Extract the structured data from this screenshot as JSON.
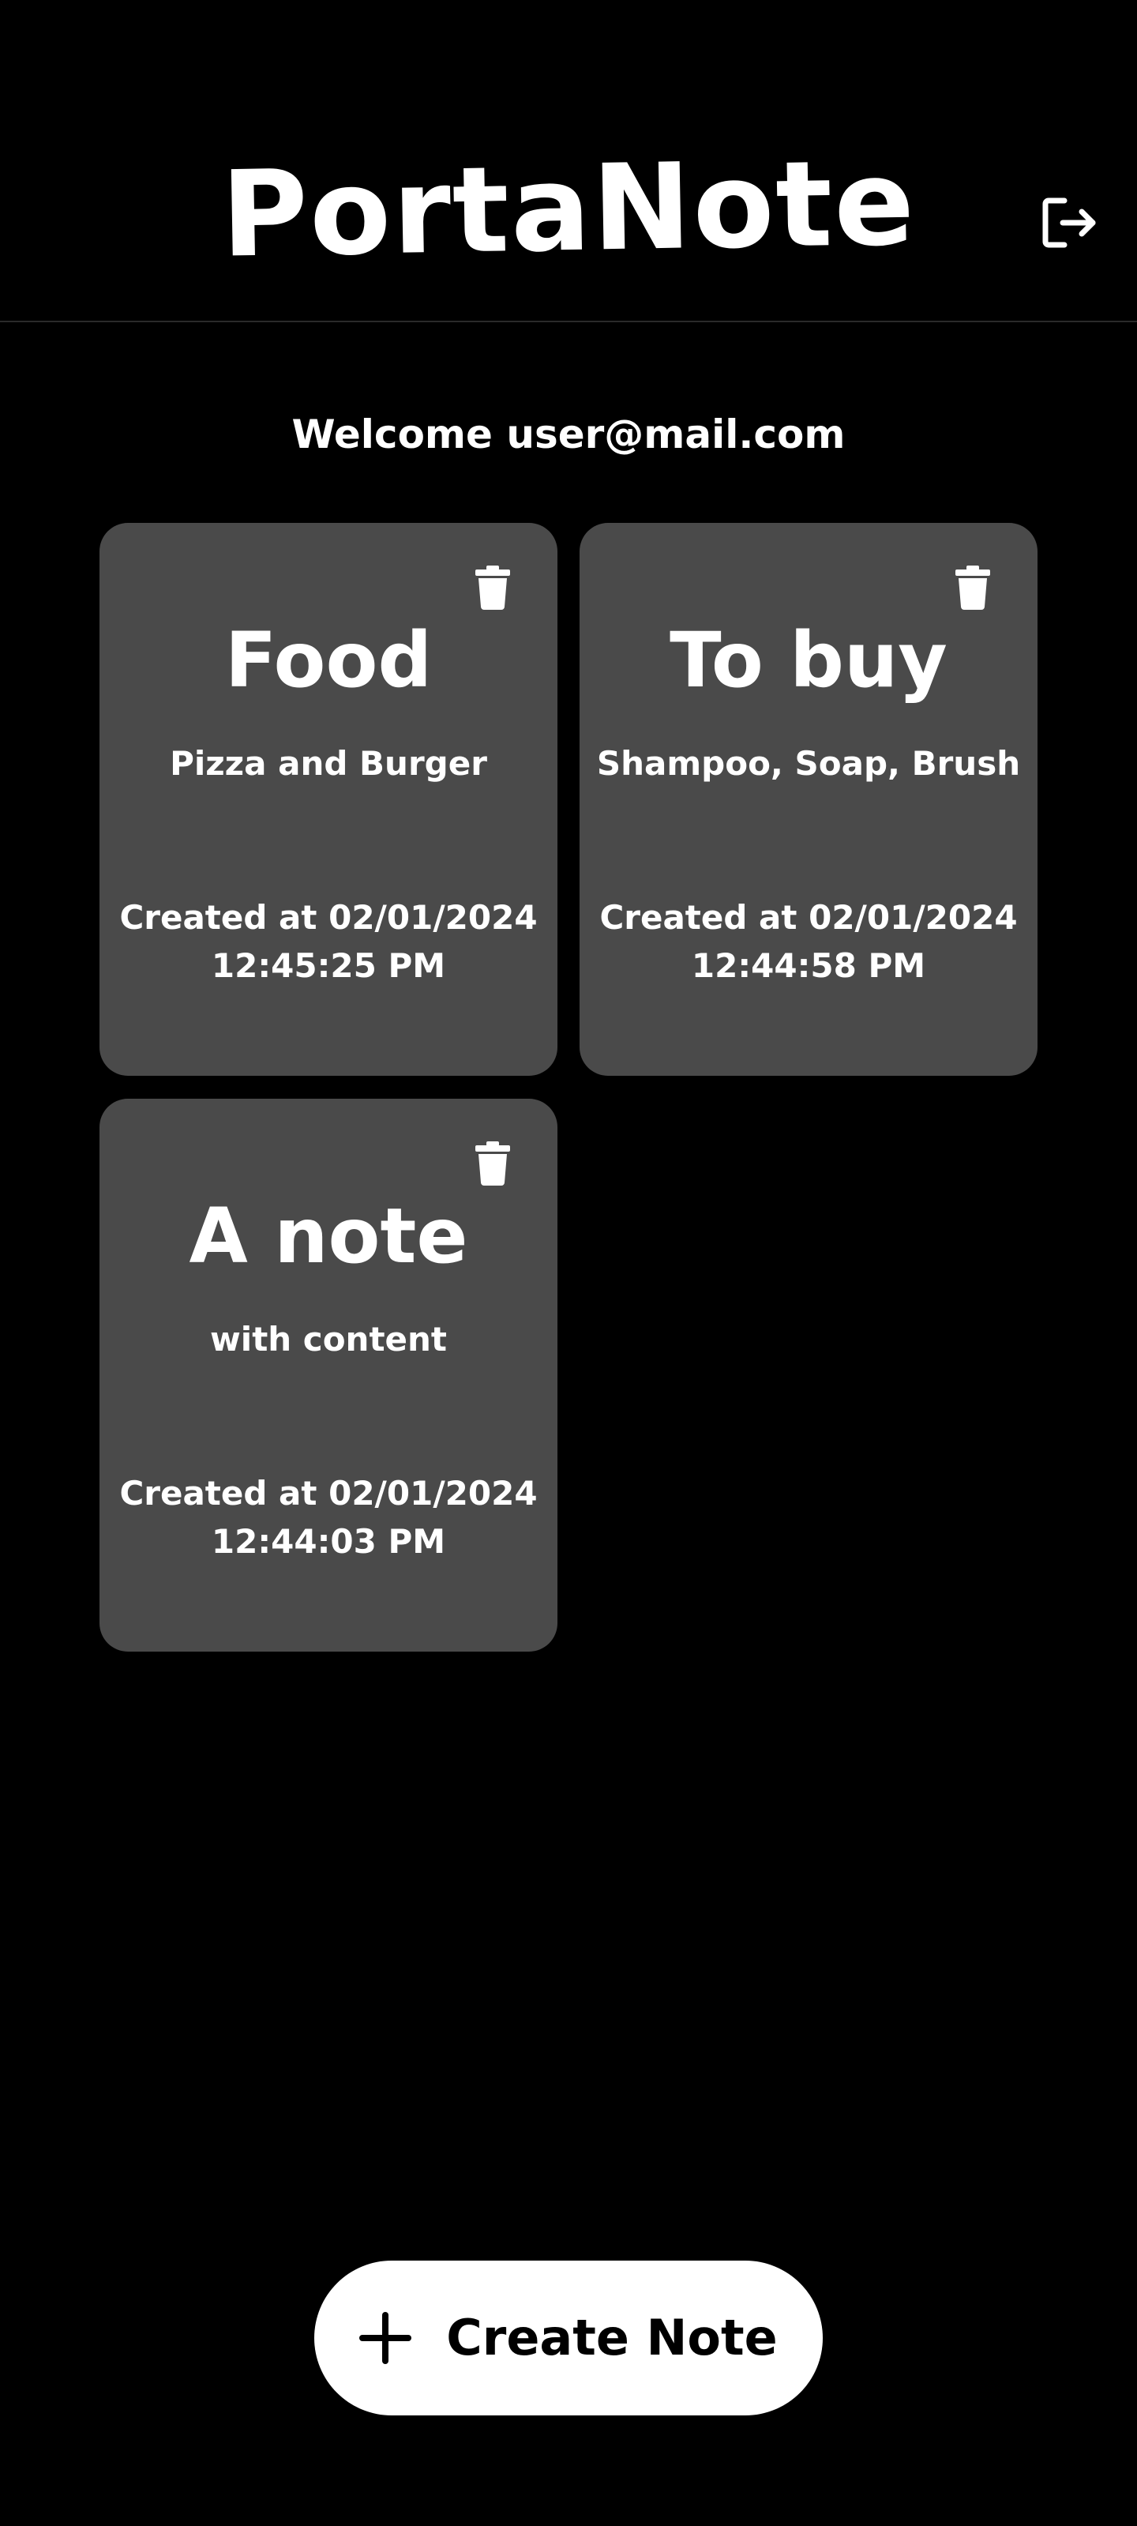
{
  "header": {
    "app_title": "PortaNote",
    "logout_icon": "logout-icon"
  },
  "welcome_text": "Welcome user@mail.com",
  "notes": [
    {
      "title": "Food",
      "content": "Pizza and Burger",
      "created_date": "Created at 02/01/2024",
      "created_time": "12:45:25 PM",
      "delete_icon": "trash-icon"
    },
    {
      "title": "To buy",
      "content": "Shampoo, Soap, Brush",
      "created_date": "Created at 02/01/2024",
      "created_time": "12:44:58 PM",
      "delete_icon": "trash-icon"
    },
    {
      "title": "A note",
      "content": "with content",
      "created_date": "Created at 02/01/2024",
      "created_time": "12:44:03 PM",
      "delete_icon": "trash-icon"
    }
  ],
  "create_button": {
    "label": "Create Note",
    "icon": "plus-icon"
  },
  "colors": {
    "background": "#000000",
    "card": "#4a4a4a",
    "text": "#ffffff",
    "button_bg": "#ffffff",
    "button_text": "#000000"
  }
}
